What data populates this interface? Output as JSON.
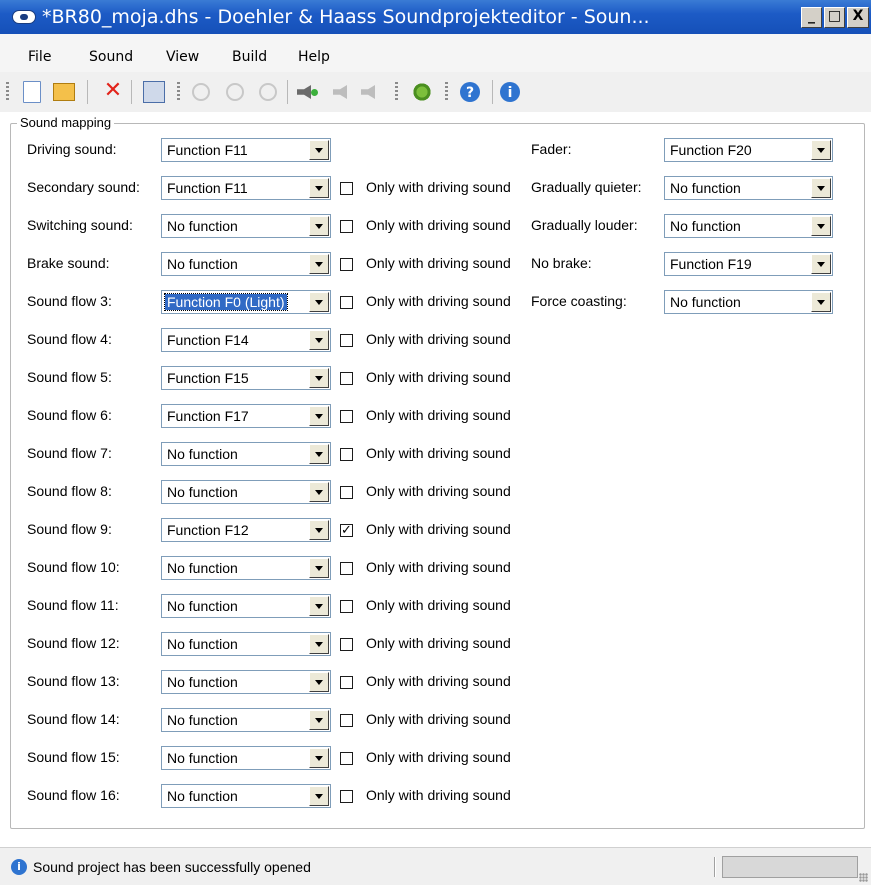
{
  "window": {
    "title": "*BR80_moja.dhs - Doehler & Haass Soundprojekteditor - Soun...",
    "min": "_",
    "max": "□",
    "close": "X"
  },
  "menu": [
    "File",
    "Sound",
    "View",
    "Build",
    "Help"
  ],
  "toolbar": {
    "icons": [
      "new-icon",
      "open-icon",
      "delete-icon",
      "save-icon",
      "play-icon",
      "pause-icon",
      "stop-icon",
      "speaker-add-icon",
      "speaker-icon",
      "speaker-volume-icon",
      "gear-icon",
      "help-icon",
      "info-icon"
    ]
  },
  "group_title": "Sound mapping",
  "option_label": "Only with driving sound",
  "left_rows": [
    {
      "label": "Driving sound:",
      "value": "Function F11",
      "checkbox": null
    },
    {
      "label": "Secondary sound:",
      "value": "Function F11",
      "checkbox": false
    },
    {
      "label": "Switching sound:",
      "value": "No function",
      "checkbox": false
    },
    {
      "label": "Brake sound:",
      "value": "No function",
      "checkbox": false
    },
    {
      "label": "Sound flow 3:",
      "value": "Function F0 (Light)",
      "checkbox": false,
      "selected": true
    },
    {
      "label": "Sound flow 4:",
      "value": "Function F14",
      "checkbox": false
    },
    {
      "label": "Sound flow 5:",
      "value": "Function F15",
      "checkbox": false
    },
    {
      "label": "Sound flow 6:",
      "value": "Function F17",
      "checkbox": false
    },
    {
      "label": "Sound flow 7:",
      "value": "No function",
      "checkbox": false
    },
    {
      "label": "Sound flow 8:",
      "value": "No function",
      "checkbox": false
    },
    {
      "label": "Sound flow 9:",
      "value": "Function F12",
      "checkbox": true
    },
    {
      "label": "Sound flow 10:",
      "value": "No function",
      "checkbox": false
    },
    {
      "label": "Sound flow 11:",
      "value": "No function",
      "checkbox": false
    },
    {
      "label": "Sound flow 12:",
      "value": "No function",
      "checkbox": false
    },
    {
      "label": "Sound flow 13:",
      "value": "No function",
      "checkbox": false
    },
    {
      "label": "Sound flow 14:",
      "value": "No function",
      "checkbox": false
    },
    {
      "label": "Sound flow 15:",
      "value": "No function",
      "checkbox": false
    },
    {
      "label": "Sound flow 16:",
      "value": "No function",
      "checkbox": false
    }
  ],
  "right_rows": [
    {
      "label": "Fader:",
      "value": "Function F20"
    },
    {
      "label": "Gradually quieter:",
      "value": "No function"
    },
    {
      "label": "Gradually louder:",
      "value": "No function"
    },
    {
      "label": "No brake:",
      "value": "Function F19"
    },
    {
      "label": "Force coasting:",
      "value": "No function"
    }
  ],
  "status": {
    "message": "Sound project has been successfully opened",
    "icon": "info-icon"
  }
}
